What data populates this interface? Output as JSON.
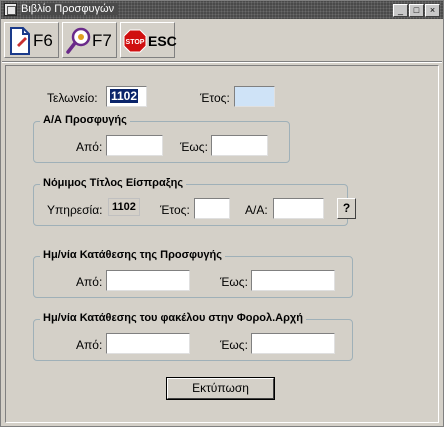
{
  "window": {
    "title": "Βιβλίο Προσφυγών"
  },
  "toolbar": {
    "f6_label": "F6",
    "f7_label": "F7",
    "esc_label": "ESC",
    "stop_text": "STOP"
  },
  "header": {
    "telonio_label": "Τελωνείο:",
    "telonio_value": "1102",
    "etos_label": "Έτος:",
    "etos_value": ""
  },
  "group_aa": {
    "title": "Α/Α Προσφυγής",
    "from_label": "Από:",
    "to_label": "Έως:",
    "from_value": "",
    "to_value": ""
  },
  "group_titlos": {
    "title": "Νόμιμος Τίτλος Είσπραξης",
    "service_label": "Υπηρεσία:",
    "service_value": "1102",
    "etos_label": "Έτος:",
    "aa_label": "Α/Α:",
    "help_label": "?"
  },
  "group_date_prosfygis": {
    "title": "Ημ/νία Κατάθεσης της  Προσφυγής",
    "from_label": "Από:",
    "to_label": "Έως:"
  },
  "group_date_fakelou": {
    "title": "Ημ/νία Κατάθεσης του φακέλου στην Φορολ.Αρχή",
    "from_label": "Από:",
    "to_label": "Έως:"
  },
  "print_button": "Εκτύπωση"
}
